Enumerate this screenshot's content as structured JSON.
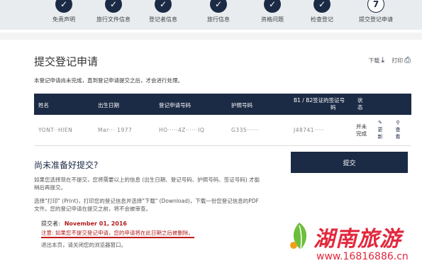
{
  "steps": [
    {
      "mark": "✓",
      "label": "免责声明"
    },
    {
      "mark": "✓",
      "label": "旅行文件信息"
    },
    {
      "mark": "✓",
      "label": "登记者信息"
    },
    {
      "mark": "✓",
      "label": "旅行信息"
    },
    {
      "mark": "✓",
      "label": "资格问题"
    },
    {
      "mark": "✓",
      "label": "检查登记"
    },
    {
      "mark": "7",
      "label": "提交登记申请"
    }
  ],
  "page": {
    "title": "提交登记申请",
    "download_label": "下载",
    "print_label": "打印",
    "info": "本登记申请尚未完成，直到登记申请提交之后，才会进行处理。"
  },
  "table": {
    "headers": {
      "name": "姓名",
      "dob": "出生日期",
      "reg_no": "登记申请号码",
      "passport": "护照号码",
      "visa_l1": "B1 / B2签证的签证号",
      "visa_l2": "码",
      "status_l1": "状",
      "status_l2": "态"
    },
    "row": {
      "name": "YONT··HIEN",
      "dob": "Mar··· 1977",
      "reg_no": "HO·····4Z······IQ",
      "passport": "G335······",
      "visa": "J48741·····",
      "status_l1": "并未",
      "status_l2": "完成",
      "edit_l1": "更",
      "edit_l2": "新",
      "view_l1": "查",
      "view_l2": "看"
    }
  },
  "bottom": {
    "subtitle": "尚未准备好提交?",
    "para1": "如果您选择现在不提交，您将需要以上的信息 (出生日期、登记号码、护照号码、签证号码) 才能稍后再提交。",
    "para2": "选择\"打印\" (Print)，打印您的登记信息并选择\"下载\" (Download)，下载一份您登记信息的PDF文件。您的登记申请在提交之前，将不会被审查。",
    "submitter_label": "提交者:",
    "submit_date": "November 01, 2016",
    "note": "注意: 如果您不提交登记申请，您的申请将在此日期之后被删除。",
    "exit": "退出本页，请关闭您的浏览器窗口。",
    "submit_button": "提交"
  },
  "watermark": {
    "brand": "湖南旅游",
    "url": "www.16816886.cn"
  },
  "colors": {
    "navy": "#1c2b45",
    "red": "#c41a1a",
    "watermark": "#e2283d"
  }
}
